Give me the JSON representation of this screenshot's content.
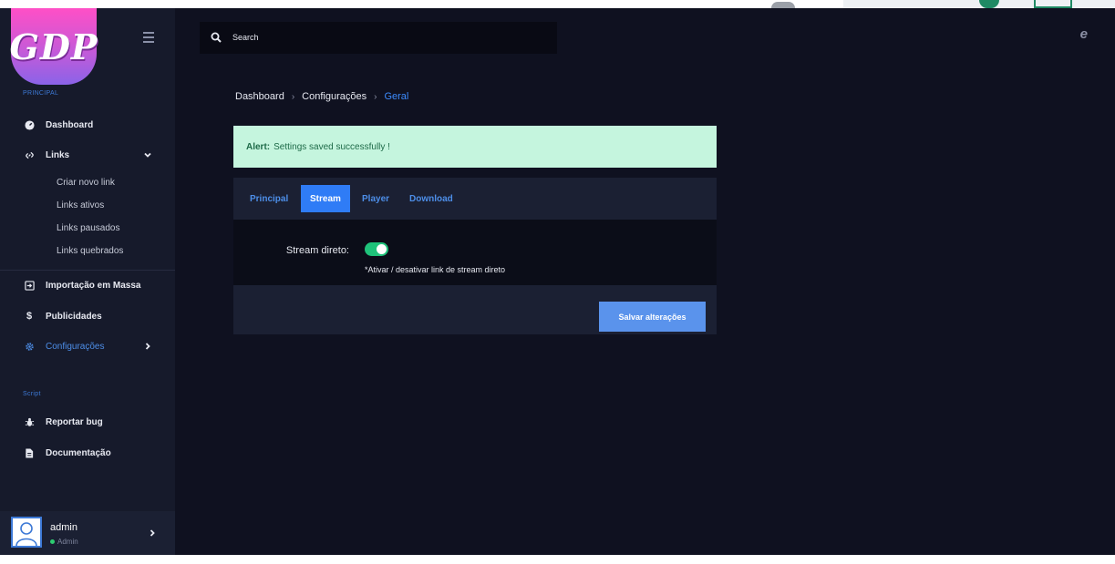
{
  "logo": {
    "text": "GDP"
  },
  "sidebar": {
    "section_principal": "PRINCIPAL",
    "section_script": "Script",
    "items": [
      {
        "label": "Dashboard",
        "icon": "gauge-icon"
      },
      {
        "label": "Links",
        "icon": "link-icon"
      },
      {
        "label": "Importação em Massa",
        "icon": "import-icon"
      },
      {
        "label": "Publicidades",
        "icon": "dollar-icon"
      },
      {
        "label": "Configurações",
        "icon": "gear-icon"
      },
      {
        "label": "Reportar bug",
        "icon": "bug-icon"
      },
      {
        "label": "Documentação",
        "icon": "document-icon"
      }
    ],
    "links_sub": [
      "Criar novo link",
      "Links ativos",
      "Links pausados",
      "Links quebrados"
    ]
  },
  "user": {
    "name": "admin",
    "role": "Admin"
  },
  "search": {
    "placeholder": "Search"
  },
  "breadcrumb": [
    "Dashboard",
    "Configurações",
    "Geral"
  ],
  "alert": {
    "label": "Alert:",
    "message": "Settings saved successfully !"
  },
  "tabs": [
    "Principal",
    "Stream",
    "Player",
    "Download"
  ],
  "active_tab": "Stream",
  "form": {
    "stream_label": "Stream direto:",
    "stream_enabled": true,
    "stream_hint": "*Ativar / desativar link de stream direto",
    "save_label": "Salvar alterações"
  },
  "colors": {
    "accent": "#2f7cf6",
    "toggle_on": "#1fc27a",
    "alert_bg": "#c5f5de",
    "background": "#0f1120",
    "sidebar": "#161a2b"
  }
}
